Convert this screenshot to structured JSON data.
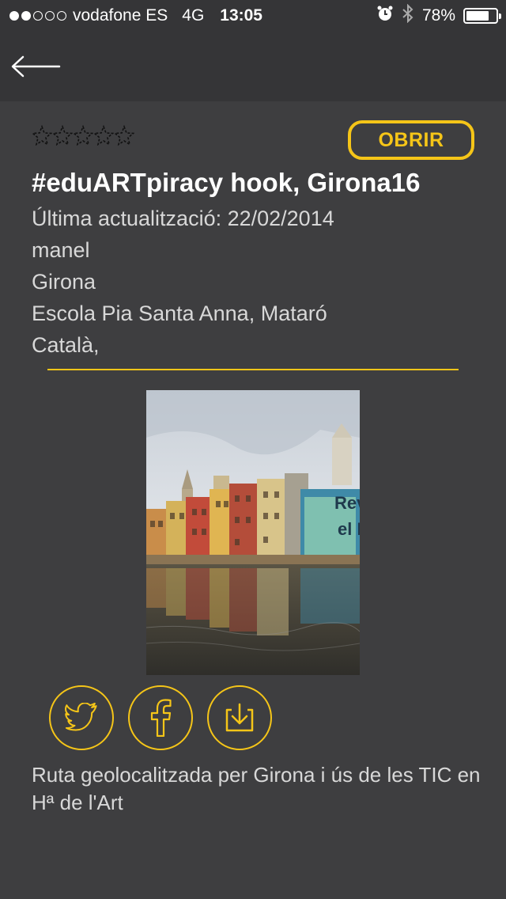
{
  "status_bar": {
    "carrier": "vodafone ES",
    "network": "4G",
    "time": "13:05",
    "battery": "78%",
    "battery_level": 0.78,
    "signal_strength": 2
  },
  "nav": {
    "back_icon": "back-arrow-icon"
  },
  "detail": {
    "rating": 0,
    "rating_max": 5,
    "open_label": "OBRIR",
    "title": "#eduARTpiracy hook, Girona16",
    "last_updated": "Última actualització: 22/02/2014",
    "author": "manel",
    "location": "Girona",
    "school": "Escola Pia Santa Anna, Mataró",
    "language": "Català,",
    "description": "Ruta geolocalitzada per Girona i ús de les TIC en Hª de l'Art"
  },
  "share": {
    "icons": [
      "twitter-icon",
      "facebook-icon",
      "download-icon"
    ]
  },
  "colors": {
    "accent": "#f5c518",
    "background": "#3e3e40",
    "bar": "#353537"
  }
}
